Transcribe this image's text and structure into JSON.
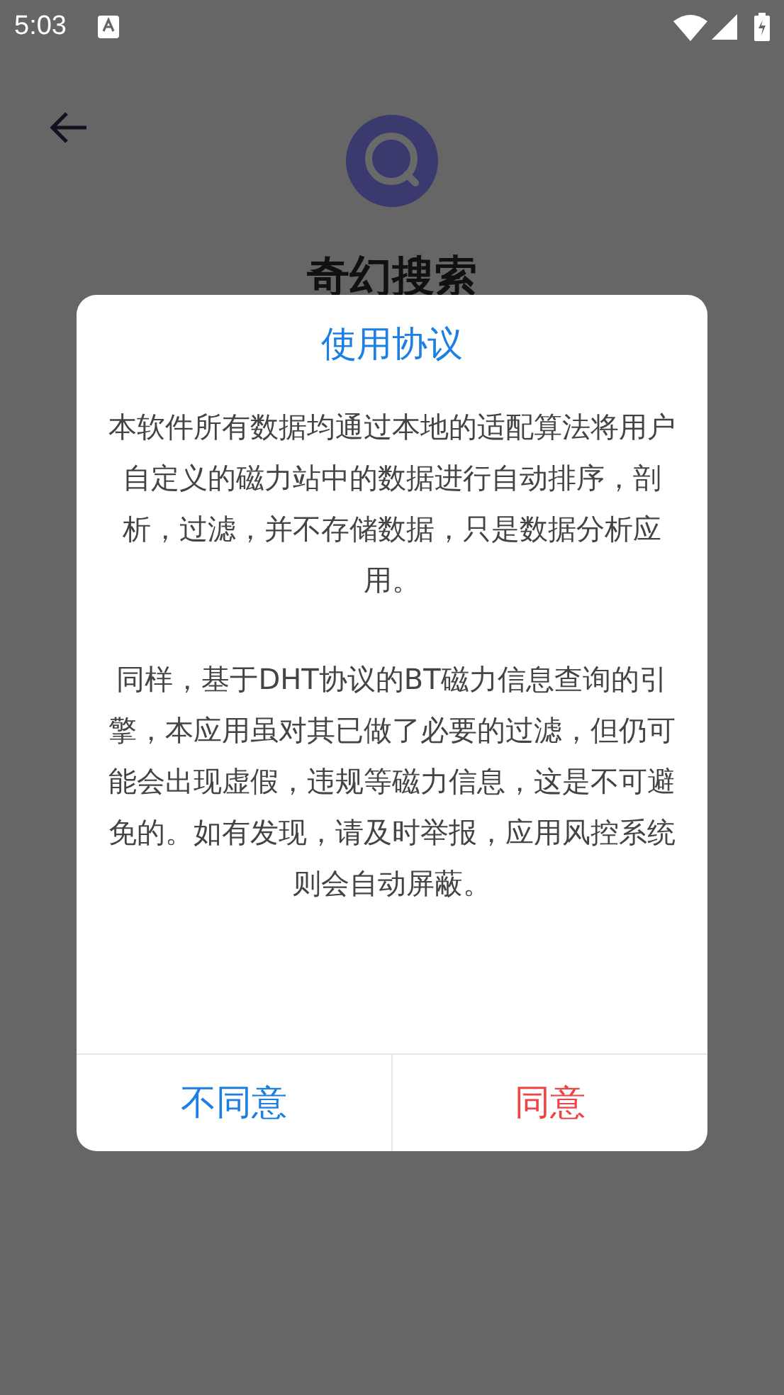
{
  "status_bar": {
    "time": "5:03"
  },
  "app": {
    "title": "奇幻搜索"
  },
  "dialog": {
    "title": "使用协议",
    "paragraphs": [
      "本软件所有数据均通过本地的适配算法将用户自定义的磁力站中的数据进行自动排序，剖析，过滤，并不存储数据，只是数据分析应用。",
      "同样，基于DHT协议的BT磁力信息查询的引擎，本应用虽对其已做了必要的过滤，但仍可能会出现虚假，违规等磁力信息，这是不可避免的。如有发现，请及时举报，应用风控系统则会自动屏蔽。"
    ],
    "buttons": [
      {
        "label": "不同意",
        "kind": "decline"
      },
      {
        "label": "同意",
        "kind": "accept"
      }
    ]
  }
}
